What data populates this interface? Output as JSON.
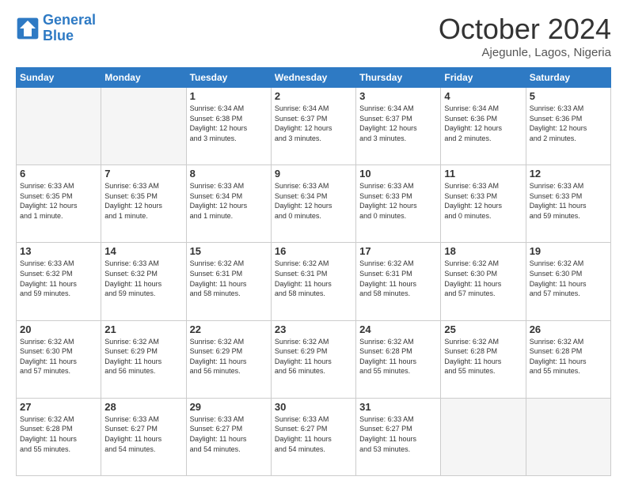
{
  "header": {
    "logo_line1": "General",
    "logo_line2": "Blue",
    "month": "October 2024",
    "location": "Ajegunle, Lagos, Nigeria"
  },
  "columns": [
    "Sunday",
    "Monday",
    "Tuesday",
    "Wednesday",
    "Thursday",
    "Friday",
    "Saturday"
  ],
  "weeks": [
    [
      {
        "day": "",
        "lines": []
      },
      {
        "day": "",
        "lines": []
      },
      {
        "day": "1",
        "lines": [
          "Sunrise: 6:34 AM",
          "Sunset: 6:38 PM",
          "Daylight: 12 hours",
          "and 3 minutes."
        ]
      },
      {
        "day": "2",
        "lines": [
          "Sunrise: 6:34 AM",
          "Sunset: 6:37 PM",
          "Daylight: 12 hours",
          "and 3 minutes."
        ]
      },
      {
        "day": "3",
        "lines": [
          "Sunrise: 6:34 AM",
          "Sunset: 6:37 PM",
          "Daylight: 12 hours",
          "and 3 minutes."
        ]
      },
      {
        "day": "4",
        "lines": [
          "Sunrise: 6:34 AM",
          "Sunset: 6:36 PM",
          "Daylight: 12 hours",
          "and 2 minutes."
        ]
      },
      {
        "day": "5",
        "lines": [
          "Sunrise: 6:33 AM",
          "Sunset: 6:36 PM",
          "Daylight: 12 hours",
          "and 2 minutes."
        ]
      }
    ],
    [
      {
        "day": "6",
        "lines": [
          "Sunrise: 6:33 AM",
          "Sunset: 6:35 PM",
          "Daylight: 12 hours",
          "and 1 minute."
        ]
      },
      {
        "day": "7",
        "lines": [
          "Sunrise: 6:33 AM",
          "Sunset: 6:35 PM",
          "Daylight: 12 hours",
          "and 1 minute."
        ]
      },
      {
        "day": "8",
        "lines": [
          "Sunrise: 6:33 AM",
          "Sunset: 6:34 PM",
          "Daylight: 12 hours",
          "and 1 minute."
        ]
      },
      {
        "day": "9",
        "lines": [
          "Sunrise: 6:33 AM",
          "Sunset: 6:34 PM",
          "Daylight: 12 hours",
          "and 0 minutes."
        ]
      },
      {
        "day": "10",
        "lines": [
          "Sunrise: 6:33 AM",
          "Sunset: 6:33 PM",
          "Daylight: 12 hours",
          "and 0 minutes."
        ]
      },
      {
        "day": "11",
        "lines": [
          "Sunrise: 6:33 AM",
          "Sunset: 6:33 PM",
          "Daylight: 12 hours",
          "and 0 minutes."
        ]
      },
      {
        "day": "12",
        "lines": [
          "Sunrise: 6:33 AM",
          "Sunset: 6:33 PM",
          "Daylight: 11 hours",
          "and 59 minutes."
        ]
      }
    ],
    [
      {
        "day": "13",
        "lines": [
          "Sunrise: 6:33 AM",
          "Sunset: 6:32 PM",
          "Daylight: 11 hours",
          "and 59 minutes."
        ]
      },
      {
        "day": "14",
        "lines": [
          "Sunrise: 6:33 AM",
          "Sunset: 6:32 PM",
          "Daylight: 11 hours",
          "and 59 minutes."
        ]
      },
      {
        "day": "15",
        "lines": [
          "Sunrise: 6:32 AM",
          "Sunset: 6:31 PM",
          "Daylight: 11 hours",
          "and 58 minutes."
        ]
      },
      {
        "day": "16",
        "lines": [
          "Sunrise: 6:32 AM",
          "Sunset: 6:31 PM",
          "Daylight: 11 hours",
          "and 58 minutes."
        ]
      },
      {
        "day": "17",
        "lines": [
          "Sunrise: 6:32 AM",
          "Sunset: 6:31 PM",
          "Daylight: 11 hours",
          "and 58 minutes."
        ]
      },
      {
        "day": "18",
        "lines": [
          "Sunrise: 6:32 AM",
          "Sunset: 6:30 PM",
          "Daylight: 11 hours",
          "and 57 minutes."
        ]
      },
      {
        "day": "19",
        "lines": [
          "Sunrise: 6:32 AM",
          "Sunset: 6:30 PM",
          "Daylight: 11 hours",
          "and 57 minutes."
        ]
      }
    ],
    [
      {
        "day": "20",
        "lines": [
          "Sunrise: 6:32 AM",
          "Sunset: 6:30 PM",
          "Daylight: 11 hours",
          "and 57 minutes."
        ]
      },
      {
        "day": "21",
        "lines": [
          "Sunrise: 6:32 AM",
          "Sunset: 6:29 PM",
          "Daylight: 11 hours",
          "and 56 minutes."
        ]
      },
      {
        "day": "22",
        "lines": [
          "Sunrise: 6:32 AM",
          "Sunset: 6:29 PM",
          "Daylight: 11 hours",
          "and 56 minutes."
        ]
      },
      {
        "day": "23",
        "lines": [
          "Sunrise: 6:32 AM",
          "Sunset: 6:29 PM",
          "Daylight: 11 hours",
          "and 56 minutes."
        ]
      },
      {
        "day": "24",
        "lines": [
          "Sunrise: 6:32 AM",
          "Sunset: 6:28 PM",
          "Daylight: 11 hours",
          "and 55 minutes."
        ]
      },
      {
        "day": "25",
        "lines": [
          "Sunrise: 6:32 AM",
          "Sunset: 6:28 PM",
          "Daylight: 11 hours",
          "and 55 minutes."
        ]
      },
      {
        "day": "26",
        "lines": [
          "Sunrise: 6:32 AM",
          "Sunset: 6:28 PM",
          "Daylight: 11 hours",
          "and 55 minutes."
        ]
      }
    ],
    [
      {
        "day": "27",
        "lines": [
          "Sunrise: 6:32 AM",
          "Sunset: 6:28 PM",
          "Daylight: 11 hours",
          "and 55 minutes."
        ]
      },
      {
        "day": "28",
        "lines": [
          "Sunrise: 6:33 AM",
          "Sunset: 6:27 PM",
          "Daylight: 11 hours",
          "and 54 minutes."
        ]
      },
      {
        "day": "29",
        "lines": [
          "Sunrise: 6:33 AM",
          "Sunset: 6:27 PM",
          "Daylight: 11 hours",
          "and 54 minutes."
        ]
      },
      {
        "day": "30",
        "lines": [
          "Sunrise: 6:33 AM",
          "Sunset: 6:27 PM",
          "Daylight: 11 hours",
          "and 54 minutes."
        ]
      },
      {
        "day": "31",
        "lines": [
          "Sunrise: 6:33 AM",
          "Sunset: 6:27 PM",
          "Daylight: 11 hours",
          "and 53 minutes."
        ]
      },
      {
        "day": "",
        "lines": []
      },
      {
        "day": "",
        "lines": []
      }
    ]
  ]
}
